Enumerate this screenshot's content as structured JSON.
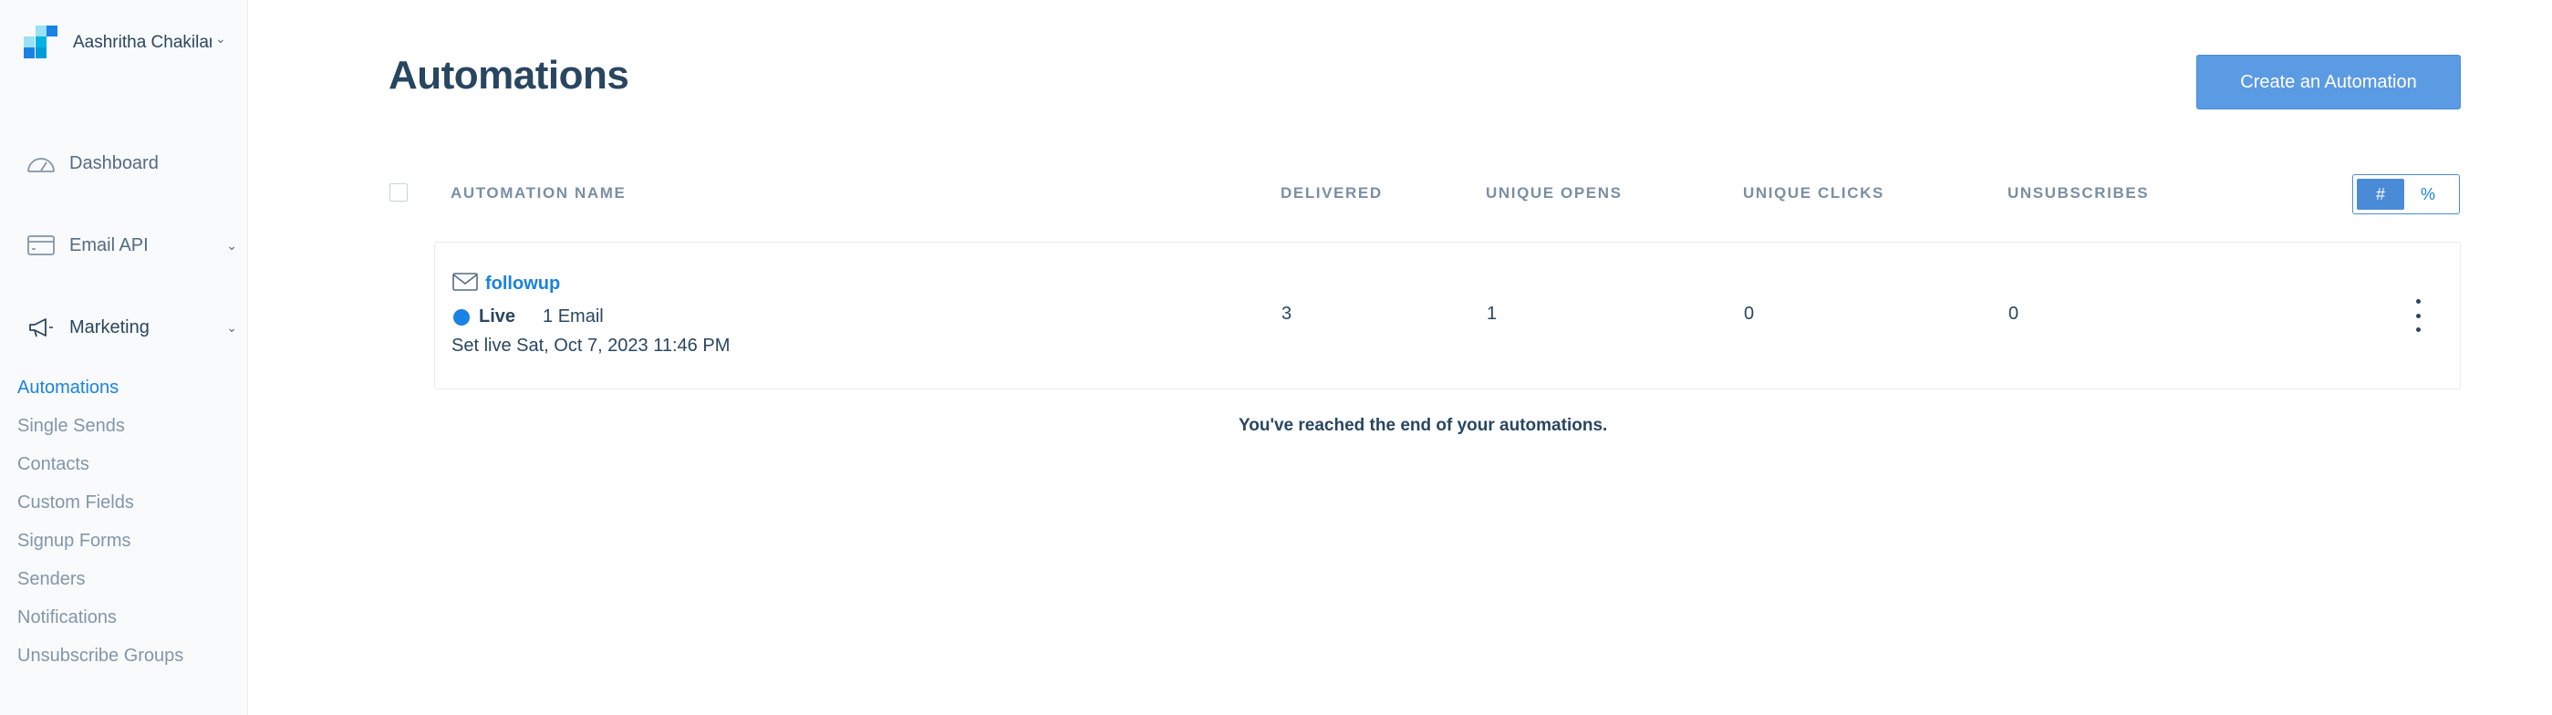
{
  "account": {
    "name": "Aashritha Chakilam"
  },
  "nav": {
    "dashboard": "Dashboard",
    "email_api": "Email API",
    "marketing": "Marketing"
  },
  "marketing_items": [
    {
      "label": "Automations",
      "active": true
    },
    {
      "label": "Single Sends"
    },
    {
      "label": "Contacts"
    },
    {
      "label": "Custom Fields"
    },
    {
      "label": "Signup Forms"
    },
    {
      "label": "Senders"
    },
    {
      "label": "Notifications"
    },
    {
      "label": "Unsubscribe Groups"
    }
  ],
  "page": {
    "title": "Automations",
    "create_button": "Create an Automation"
  },
  "table": {
    "headers": {
      "name": "AUTOMATION NAME",
      "delivered": "DELIVERED",
      "opens": "UNIQUE OPENS",
      "clicks": "UNIQUE CLICKS",
      "unsubscribes": "UNSUBSCRIBES"
    },
    "toggle": {
      "count": "#",
      "percent": "%",
      "selected": "#"
    },
    "rows": [
      {
        "name": "followup",
        "status": "Live",
        "emails": "1 Email",
        "set_live": "Set live Sat, Oct 7, 2023 11:46 PM",
        "delivered": "3",
        "opens": "1",
        "clicks": "0",
        "unsubscribes": "0"
      }
    ],
    "end_note": "You've reached the end of your automations."
  },
  "colors": {
    "accent": "#1a82e2",
    "button": "#5b9be3",
    "text": "#294661",
    "muted": "#8196a9",
    "sidebar_bg": "#f9fafb"
  }
}
